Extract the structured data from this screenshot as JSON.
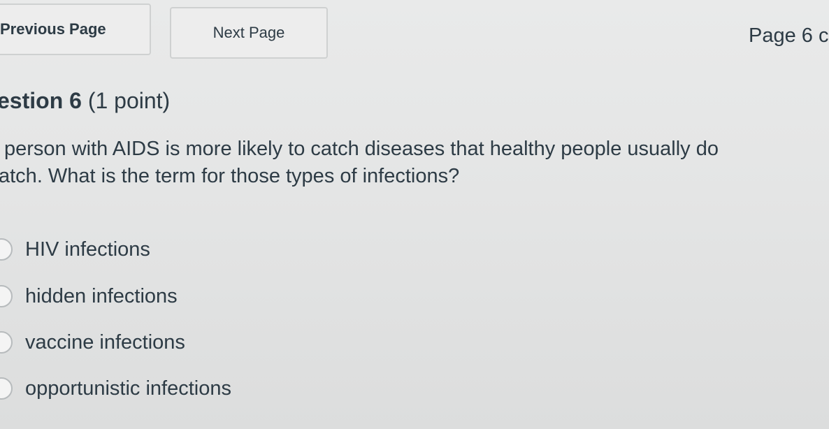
{
  "nav": {
    "previous_label": "Previous Page",
    "next_label": "Next Page",
    "page_indicator": "Page 6 c"
  },
  "question": {
    "title_prefix": "estion 6",
    "points": "(1 point)",
    "text_line1": "person with AIDS is more likely to catch diseases that healthy people usually do",
    "text_line2": "atch. What is the term for those types of infections?"
  },
  "options": [
    {
      "label": "HIV infections",
      "selected": false
    },
    {
      "label": "hidden infections",
      "selected": false
    },
    {
      "label": "vaccine infections",
      "selected": false
    },
    {
      "label": "opportunistic infections",
      "selected": false
    }
  ]
}
